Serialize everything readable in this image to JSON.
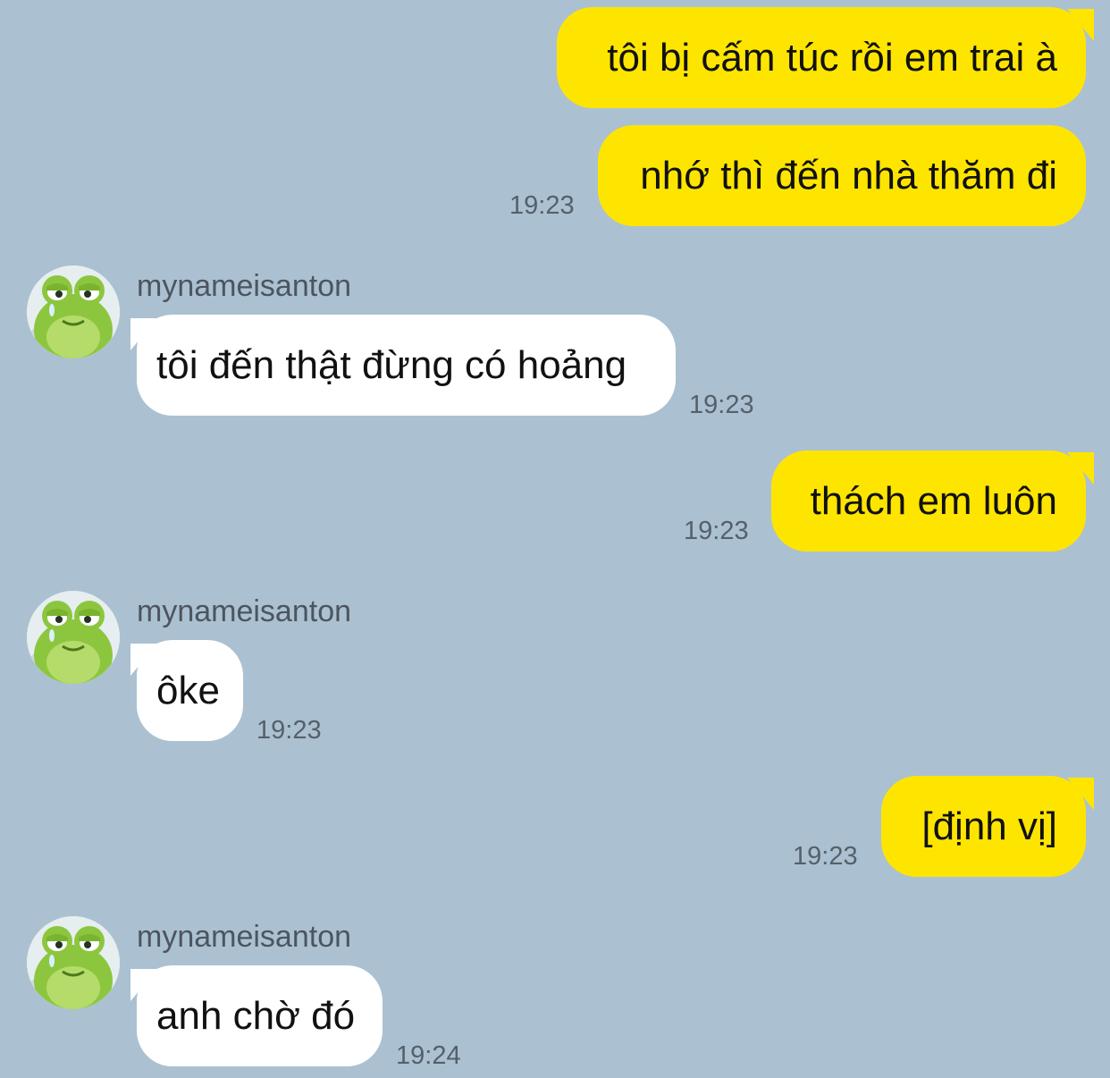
{
  "conversation": {
    "sender_name": "mynameisanton",
    "avatar_icon": "frog-avatar-icon",
    "colors": {
      "background": "#abc1d1",
      "outgoing_bubble": "#fee500",
      "incoming_bubble": "#ffffff",
      "timestamp": "#55606b"
    },
    "messages": [
      {
        "direction": "outgoing",
        "text": "tôi bị cấm túc rồi em trai à",
        "time": ""
      },
      {
        "direction": "outgoing",
        "text": "nhớ thì đến nhà thăm đi",
        "time": "19:23"
      },
      {
        "direction": "incoming",
        "sender": "mynameisanton",
        "text": "tôi đến thật đừng có hoảng",
        "time": "19:23"
      },
      {
        "direction": "outgoing",
        "text": "thách em luôn",
        "time": "19:23"
      },
      {
        "direction": "incoming",
        "sender": "mynameisanton",
        "text": "ôke",
        "time": "19:23"
      },
      {
        "direction": "outgoing",
        "text": "[định vị]",
        "time": "19:23"
      },
      {
        "direction": "incoming",
        "sender": "mynameisanton",
        "text": "anh chờ đó",
        "time": "19:24"
      }
    ]
  }
}
